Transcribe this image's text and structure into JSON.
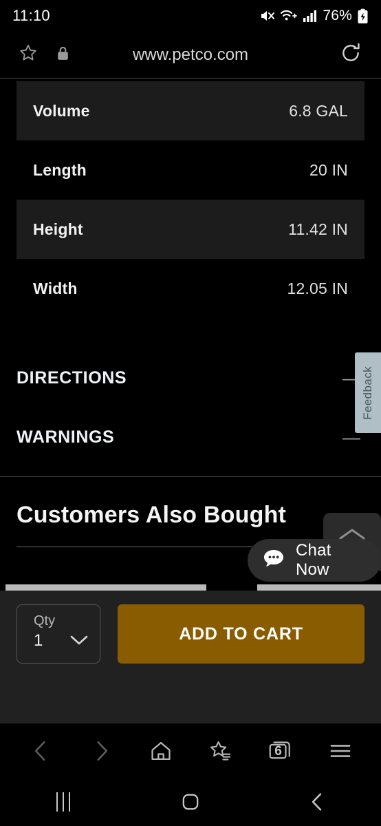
{
  "status_bar": {
    "time": "11:10",
    "battery_percent": "76%",
    "icons": [
      "mute-icon",
      "wifi-icon",
      "signal-icon",
      "battery-charging-icon"
    ]
  },
  "browser": {
    "url": "www.petco.com",
    "bookmark_icon": "star-icon",
    "lock_icon": "lock-icon",
    "reload_icon": "reload-icon",
    "toolbar": {
      "back": "back-icon",
      "forward": "forward-icon",
      "home": "home-icon",
      "bookmarks": "bookmarks-star-icon",
      "tabs_count": "6",
      "menu": "menu-icon"
    }
  },
  "specs": {
    "rows": [
      {
        "label": "Volume",
        "value": "6.8 GAL"
      },
      {
        "label": "Length",
        "value": "20 IN"
      },
      {
        "label": "Height",
        "value": "11.42 IN"
      },
      {
        "label": "Width",
        "value": "12.05 IN"
      }
    ]
  },
  "accordions": [
    {
      "title": "DIRECTIONS",
      "sign": "—"
    },
    {
      "title": "WARNINGS",
      "sign": "—"
    }
  ],
  "customers_also_bought": {
    "title": "Customers Also Bought"
  },
  "feedback_tab": {
    "label": "Feedback",
    "bg_color": "#b0bec6",
    "text_color": "#4b5860"
  },
  "chat": {
    "label": "Chat Now",
    "icon": "chat-bubble-icon"
  },
  "scroll_top": {
    "icon": "chevron-up-icon"
  },
  "buy_bar": {
    "qty_label": "Qty",
    "qty_value": "1",
    "qty_chevron": "chevron-down-icon",
    "add_to_cart_label": "ADD TO CART",
    "add_to_cart_color": "#8a5c02"
  },
  "android_nav": {
    "recents": "recents-icon",
    "home": "home-circle-icon",
    "back": "back-chevron-icon"
  }
}
